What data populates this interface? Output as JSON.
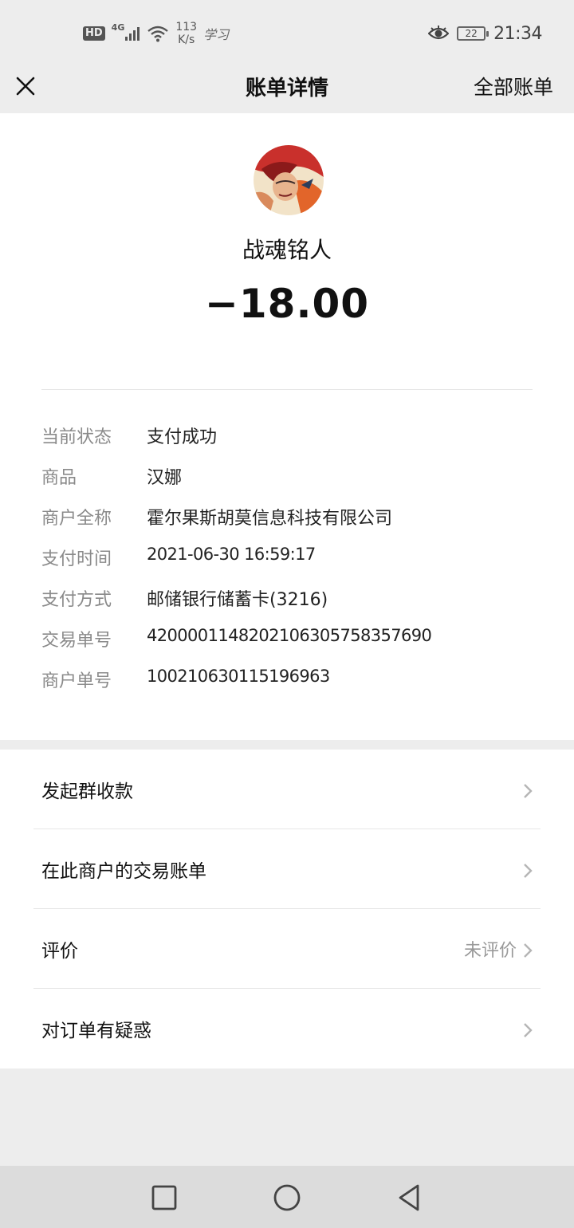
{
  "status_bar": {
    "hd": "HD",
    "network": "4G",
    "speed_value": "113",
    "speed_unit": "K/s",
    "app_note": "学习",
    "battery": "22",
    "time": "21:34"
  },
  "nav": {
    "title": "账单详情",
    "right_label": "全部账单"
  },
  "bill": {
    "merchant_name": "战魂铭人",
    "amount": "−18.00",
    "details": [
      {
        "label": "当前状态",
        "value": "支付成功"
      },
      {
        "label": "商品",
        "value": "汉娜"
      },
      {
        "label": "商户全称",
        "value": "霍尔果斯胡莫信息科技有限公司"
      },
      {
        "label": "支付时间",
        "value": "2021-06-30 16:59:17"
      },
      {
        "label": "支付方式",
        "value": "邮储银行储蓄卡(3216)"
      },
      {
        "label": "交易单号",
        "value": "4200001148202106305758357690"
      },
      {
        "label": "商户单号",
        "value": "100210630115196963"
      }
    ]
  },
  "actions": [
    {
      "label": "发起群收款",
      "side": ""
    },
    {
      "label": "在此商户的交易账单",
      "side": ""
    },
    {
      "label": "评价",
      "side": "未评价"
    },
    {
      "label": "对订单有疑惑",
      "side": ""
    }
  ],
  "colors": {
    "page_bg": "#ededed",
    "card_bg": "#ffffff",
    "label_gray": "#8a8a8a",
    "text": "#111111"
  },
  "icons": [
    "close-icon",
    "eye-icon",
    "wifi-icon",
    "signal-icon",
    "battery-icon",
    "chevron-right-icon",
    "recent-apps-icon",
    "home-icon",
    "back-icon"
  ]
}
